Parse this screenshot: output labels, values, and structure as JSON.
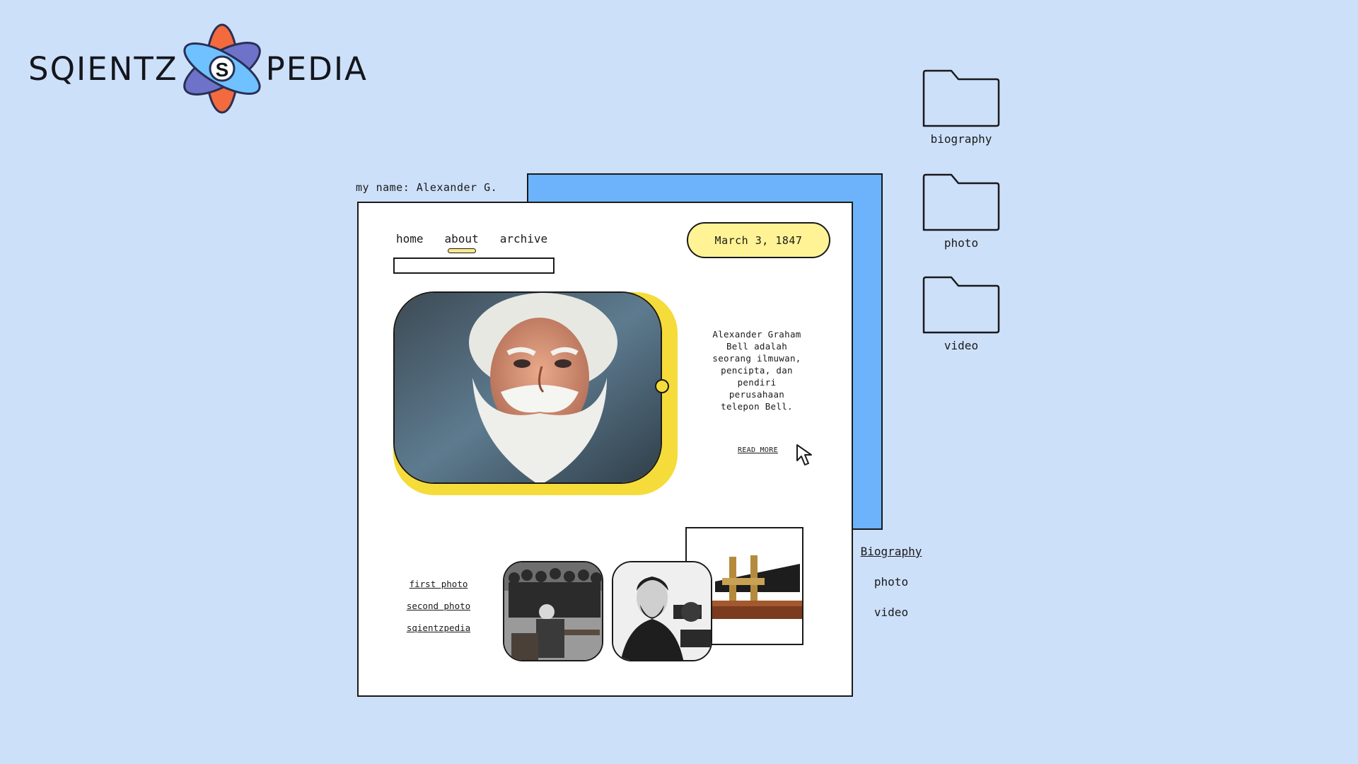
{
  "logo": {
    "left": "SQIENTZ",
    "mark_letter": "S",
    "right": "PEDIA"
  },
  "profile": {
    "my_name": "my name: Alexander G."
  },
  "nav": {
    "items": [
      "home",
      "about",
      "archive"
    ],
    "active": "about"
  },
  "search": {
    "value": "",
    "placeholder": ""
  },
  "date": "March 3, 1847",
  "description": [
    "Alexander Graham",
    "Bell adalah",
    "seorang ilmuwan,",
    "pencipta, dan",
    "pendiri",
    "perusahaan",
    "telepon Bell."
  ],
  "read_more": "READ MORE",
  "links": [
    "first photo",
    "second photo",
    "sqientzpedia"
  ],
  "side_links": [
    "Biography",
    "photo",
    "video"
  ],
  "folders": [
    "biography",
    "photo",
    "video"
  ],
  "colors": {
    "background": "#cde0fa",
    "accent_blue": "#6cb3fb",
    "accent_yellow": "#f5dc3a",
    "pill_yellow": "#fff395"
  }
}
